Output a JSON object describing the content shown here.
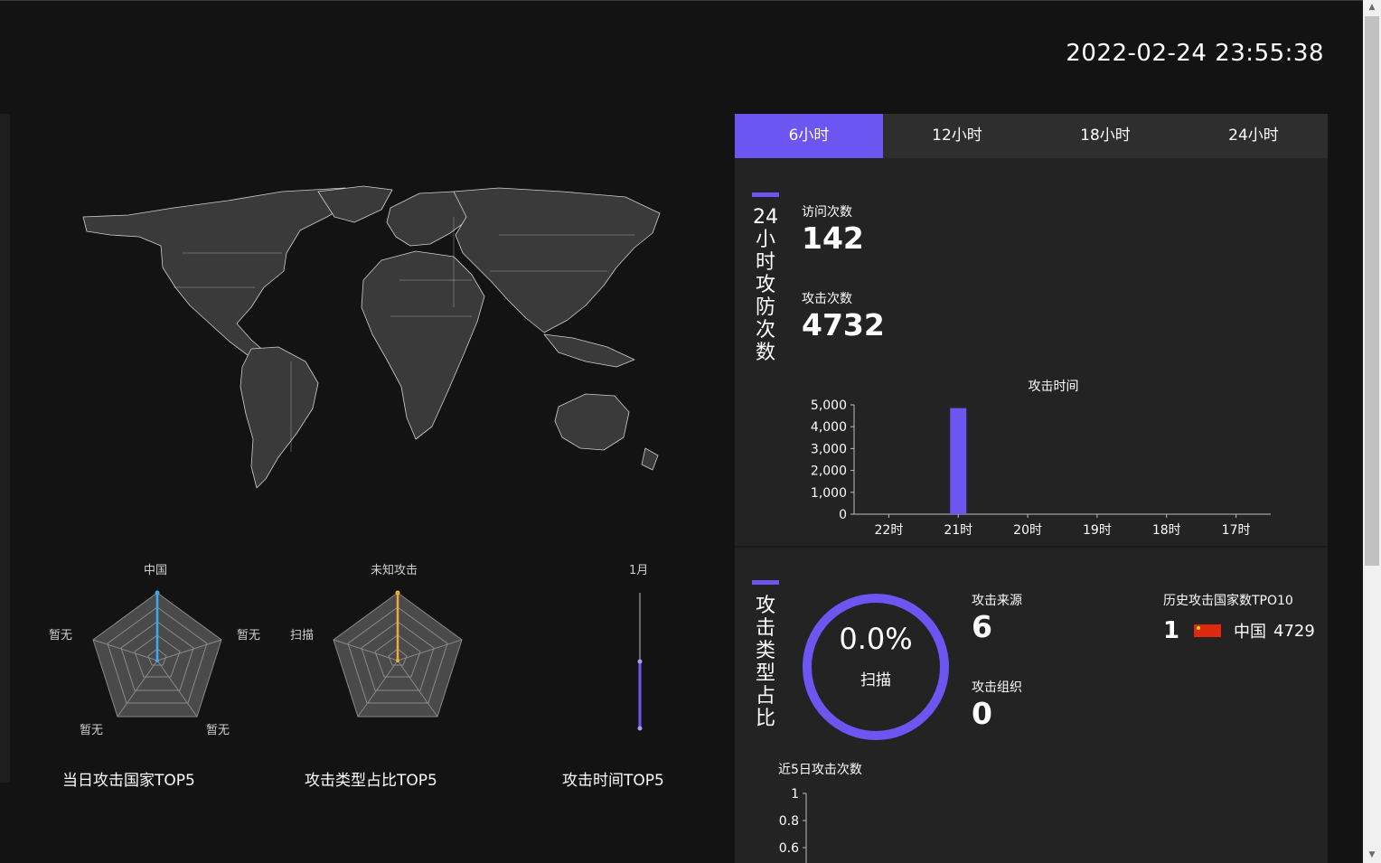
{
  "header": {
    "datetime": "2022-02-24 23:55:38"
  },
  "time_tabs": [
    {
      "label": "6小时",
      "active": true
    },
    {
      "label": "12小时",
      "active": false
    },
    {
      "label": "18小时",
      "active": false
    },
    {
      "label": "24小时",
      "active": false
    }
  ],
  "stats_24h": {
    "title": "24小时攻防次数",
    "visits_label": "访问次数",
    "visits": "142",
    "attacks_label": "攻击次数",
    "attacks": "4732"
  },
  "attack_type": {
    "title": "攻击类型占比",
    "ring_percent": "0.0%",
    "ring_label": "扫描",
    "source_label": "攻击来源",
    "source_value": "6",
    "org_label": "攻击组织",
    "org_value": "0",
    "history_title": "历史攻击国家数TPO10",
    "history": [
      {
        "rank": "1",
        "country": "中国",
        "count": "4729"
      }
    ]
  },
  "radar_country": {
    "caption": "当日攻击国家TOP5",
    "indicators": [
      "中国",
      "暂无",
      "暂无",
      "暂无",
      "暂无"
    ],
    "value_fraction": [
      1,
      0,
      0,
      0,
      0
    ],
    "color": "#3ea8f0"
  },
  "radar_type": {
    "caption": "攻击类型占比TOP5",
    "indicators": [
      "未知攻击",
      "扫描"
    ],
    "value_fraction": [
      1,
      0,
      0,
      0,
      0
    ],
    "color": "#f0a93a"
  },
  "time_top": {
    "caption": "攻击时间TOP5",
    "label": "1月"
  },
  "chart_data": [
    {
      "type": "bar",
      "title": "攻击时间",
      "categories": [
        "22时",
        "21时",
        "20时",
        "19时",
        "18时",
        "17时"
      ],
      "values": [
        0,
        4850,
        0,
        0,
        0,
        0
      ],
      "yticks": [
        "0",
        "1,000",
        "2,000",
        "3,000",
        "4,000",
        "5,000"
      ],
      "ylim": [
        0,
        5000
      ],
      "color": "#6d55f2"
    },
    {
      "type": "line",
      "title": "近5日攻击次数",
      "yticks": [
        "0.6",
        "0.8",
        "1"
      ]
    }
  ],
  "colors": {
    "accent": "#6d55f2",
    "panel": "#232324",
    "background": "#131314"
  }
}
